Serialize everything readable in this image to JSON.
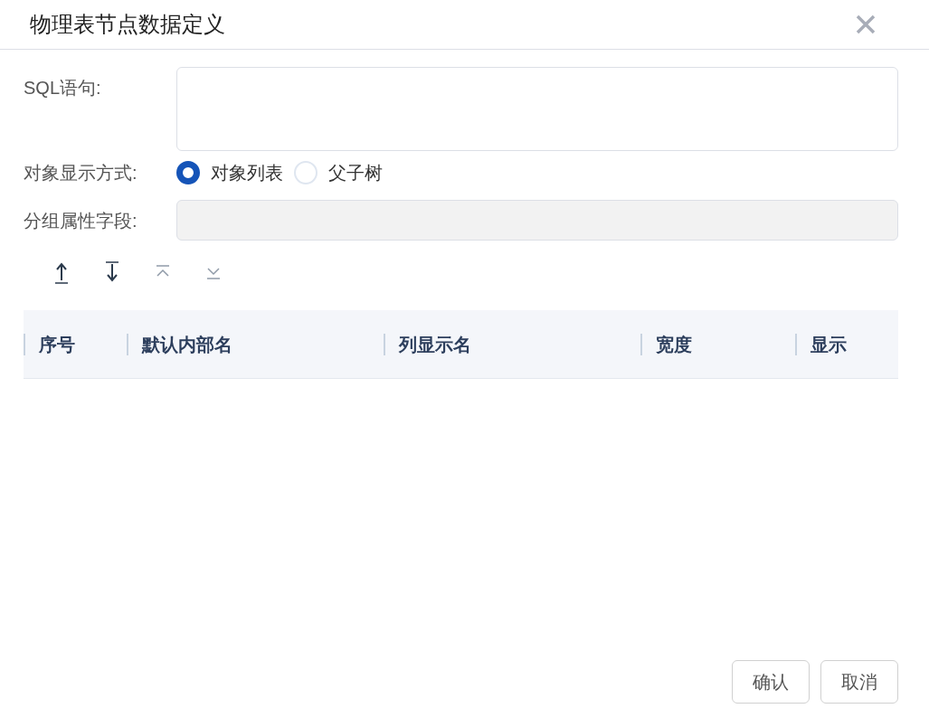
{
  "dialog": {
    "title": "物理表节点数据定义"
  },
  "form": {
    "sql_label": "SQL语句:",
    "display_label": "对象显示方式:",
    "display_options": [
      {
        "label": "对象列表",
        "selected": true
      },
      {
        "label": "父子树",
        "selected": false
      }
    ],
    "group_label": "分组属性字段:",
    "group_field": {
      "disabled": true
    }
  },
  "toolbar": [
    {
      "kind": "top",
      "disabled": false
    },
    {
      "kind": "bottom",
      "disabled": false
    },
    {
      "kind": "up",
      "disabled": true
    },
    {
      "kind": "down",
      "disabled": true
    }
  ],
  "table": {
    "columns": [
      "序号",
      "默认内部名",
      "列显示名",
      "宽度",
      "显示"
    ]
  },
  "buttons": [
    "确认",
    "取消"
  ]
}
